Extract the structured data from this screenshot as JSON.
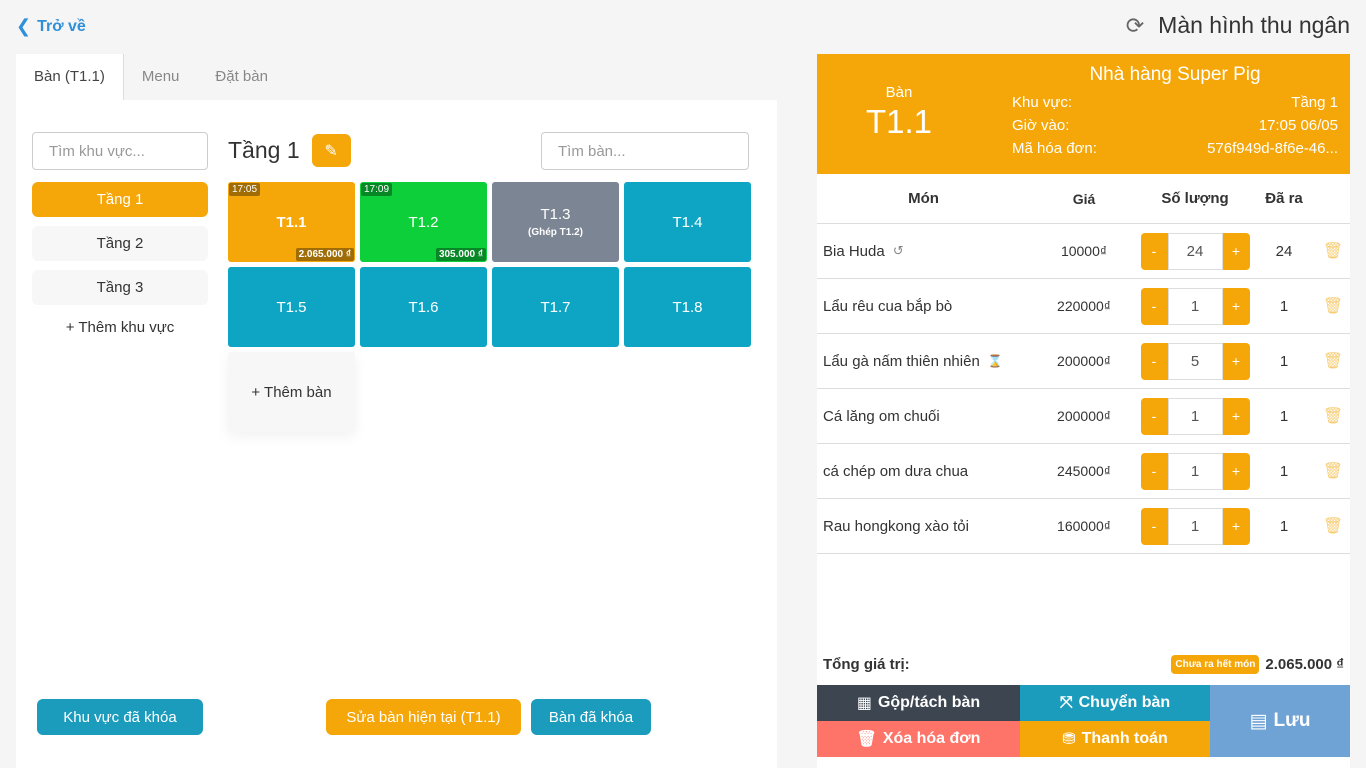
{
  "nav": {
    "back_label": "Trở về",
    "screen_title": "Màn hình thu ngân"
  },
  "tabs": [
    {
      "label": "Bàn (T1.1)"
    },
    {
      "label": "Menu"
    },
    {
      "label": "Đặt bàn"
    }
  ],
  "areas": {
    "search_placeholder": "Tìm khu vực...",
    "items": [
      {
        "label": "Tầng 1"
      },
      {
        "label": "Tầng 2"
      },
      {
        "label": "Tầng 3"
      }
    ],
    "add_label": "+ Thêm khu vực"
  },
  "floor": {
    "title": "Tầng 1",
    "search_placeholder": "Tìm bàn...",
    "tables": [
      {
        "name": "T1.1",
        "time": "17:05",
        "amount": "2.065.000 ₫",
        "sub": ""
      },
      {
        "name": "T1.2",
        "time": "17:09",
        "amount": "305.000 ₫",
        "sub": ""
      },
      {
        "name": "T1.3",
        "time": "",
        "amount": "",
        "sub": "(Ghép T1.2)"
      },
      {
        "name": "T1.4",
        "time": "",
        "amount": "",
        "sub": ""
      },
      {
        "name": "T1.5",
        "time": "",
        "amount": "",
        "sub": ""
      },
      {
        "name": "T1.6",
        "time": "",
        "amount": "",
        "sub": ""
      },
      {
        "name": "T1.7",
        "time": "",
        "amount": "",
        "sub": ""
      },
      {
        "name": "T1.8",
        "time": "",
        "amount": "",
        "sub": ""
      }
    ],
    "add_table_label": "+ Thêm bàn"
  },
  "bottom_buttons": {
    "locked_areas": "Khu vực đã khóa",
    "edit_current": "Sửa bàn hiện tại (T1.1)",
    "locked_tables": "Bàn đã khóa"
  },
  "order": {
    "table_label": "Bàn",
    "table_code": "T1.1",
    "restaurant_name": "Nhà hàng Super Pig",
    "area_label": "Khu vực:",
    "area_value": "Tầng 1",
    "checkin_label": "Giờ vào:",
    "checkin_value": "17:05 06/05",
    "invoice_label": "Mã hóa đơn:",
    "invoice_value": "576f949d-8f6e-46...",
    "columns": {
      "name": "Món",
      "price": "Giá",
      "qty": "Số lượng",
      "served": "Đã ra"
    },
    "items": [
      {
        "name": "Bia Huda",
        "price": "10000₫",
        "qty": "24",
        "served": "24",
        "icon": "undo"
      },
      {
        "name": "Lẩu rêu cua bắp bò",
        "price": "220000₫",
        "qty": "1",
        "served": "1",
        "icon": ""
      },
      {
        "name": "Lẩu gà nấm thiên nhiên",
        "price": "200000₫",
        "qty": "5",
        "served": "1",
        "icon": "hourglass"
      },
      {
        "name": "Cá lăng om chuối",
        "price": "200000₫",
        "qty": "1",
        "served": "1",
        "icon": ""
      },
      {
        "name": "cá chép om dưa chua",
        "price": "245000₫",
        "qty": "1",
        "served": "1",
        "icon": ""
      },
      {
        "name": "Rau hongkong xào tỏi",
        "price": "160000₫",
        "qty": "1",
        "served": "1",
        "icon": ""
      }
    ],
    "stepper": {
      "minus": "-",
      "plus": "+"
    },
    "total_label": "Tổng giá trị:",
    "total_badge": "Chưa ra hết món",
    "total_value": "2.065.000 ₫"
  },
  "actions": {
    "merge": "Gộp/tách bàn",
    "move": "Chuyển bàn",
    "delete": "Xóa hóa đơn",
    "pay": "Thanh toán",
    "save": "Lưu"
  },
  "colors": {
    "accent_orange": "#f5a70a",
    "teal": "#0ea5c4",
    "green": "#0ccf3a",
    "gray_merged": "#7b8593",
    "red": "#ff7468",
    "dark": "#3c4550",
    "save_blue": "#6fa3d6"
  }
}
